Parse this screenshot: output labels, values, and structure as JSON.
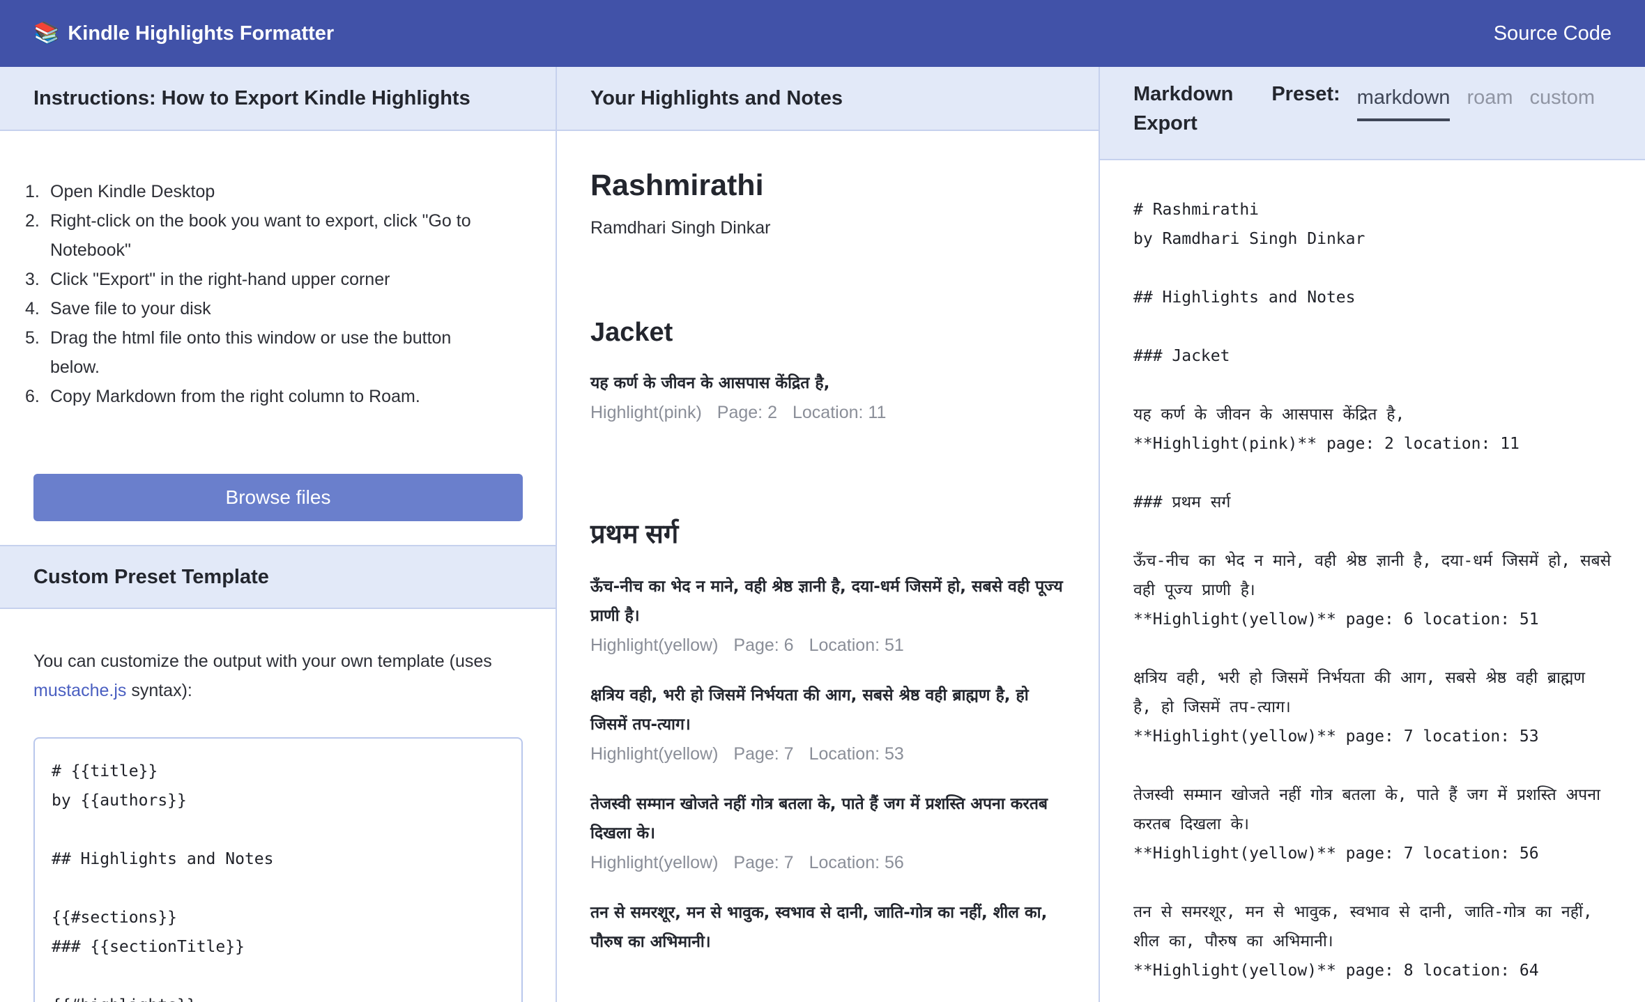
{
  "header": {
    "logo_icon": "📚",
    "app_title": "Kindle Highlights Formatter",
    "source_link": "Source Code"
  },
  "instructions": {
    "heading": "Instructions: How to Export Kindle Highlights",
    "steps": [
      "Open Kindle Desktop",
      "Right-click on the book you want to export, click \"Go to Notebook\"",
      "Click \"Export\" in the right-hand upper corner",
      "Save file to your disk",
      "Drag the html file onto this window or use the button below.",
      "Copy Markdown from the right column to Roam."
    ],
    "browse_button": "Browse files"
  },
  "custom_preset": {
    "heading": "Custom Preset Template",
    "text_before": "You can customize the output with your own template (uses ",
    "link_text": "mustache.js",
    "text_after": " syntax):",
    "template": "# {{title}}\nby {{authors}}\n\n## Highlights and Notes\n\n{{#sections}}\n### {{sectionTitle}}\n\n{{#highlights}}"
  },
  "highlights_panel": {
    "heading": "Your Highlights and Notes",
    "book_title": "Rashmirathi",
    "book_author": "Ramdhari Singh Dinkar",
    "sections": [
      {
        "title": "Jacket",
        "highlights": [
          {
            "text": "यह कर्ण के जीवन के आसपास केंद्रित है,",
            "type": "Highlight(pink)",
            "page": "Page: 2",
            "location": "Location: 11"
          }
        ]
      },
      {
        "title": "प्रथम सर्ग",
        "highlights": [
          {
            "text": "ऊँच-नीच का भेद न माने, वही श्रेष्ठ ज्ञानी है, दया-धर्म जिसमें हो, सबसे वही पूज्य प्राणी है।",
            "type": "Highlight(yellow)",
            "page": "Page: 6",
            "location": "Location: 51"
          },
          {
            "text": "क्षत्रिय वही, भरी हो जिसमें निर्भयता की आग, सबसे श्रेष्ठ वही ब्राह्मण है, हो जिसमें तप-त्याग।",
            "type": "Highlight(yellow)",
            "page": "Page: 7",
            "location": "Location: 53"
          },
          {
            "text": "तेजस्वी सम्मान खोजते नहीं गोत्र बतला के, पाते हैं जग में प्रशस्ति अपना करतब दिखला के।",
            "type": "Highlight(yellow)",
            "page": "Page: 7",
            "location": "Location: 56"
          },
          {
            "text": "तन से समरशूर, मन से भावुक, स्वभाव से दानी, जाति-गोत्र का नहीं, शील का, पौरुष का अभिमानी।",
            "type": "",
            "page": "",
            "location": ""
          }
        ]
      }
    ]
  },
  "export_panel": {
    "heading": "Markdown Export",
    "preset_label": "Preset:",
    "tabs": [
      "markdown",
      "roam",
      "custom"
    ],
    "active_tab": "markdown",
    "output": "# Rashmirathi\nby Ramdhari Singh Dinkar\n\n## Highlights and Notes\n\n### Jacket\n\nयह कर्ण के जीवन के आसपास केंद्रित है,\n**Highlight(pink)** page: 2 location: 11\n\n### प्रथम सर्ग\n\nऊँच-नीच का भेद न माने, वही श्रेष्ठ ज्ञानी है, दया-धर्म जिसमें हो, सबसे वही पूज्य प्राणी है।\n**Highlight(yellow)** page: 6 location: 51\n\nक्षत्रिय वही, भरी हो जिसमें निर्भयता की आग, सबसे श्रेष्ठ वही ब्राह्मण है, हो जिसमें तप-त्याग।\n**Highlight(yellow)** page: 7 location: 53\n\nतेजस्वी सम्मान खोजते नहीं गोत्र बतला के, पाते हैं जग में प्रशस्ति अपना करतब दिखला के।\n**Highlight(yellow)** page: 7 location: 56\n\nतन से समरशूर, मन से भावुक, स्वभाव से दानी, जाति-गोत्र का नहीं, शील का, पौरुष का अभिमानी।\n**Highlight(yellow)** page: 8 location: 64"
  }
}
